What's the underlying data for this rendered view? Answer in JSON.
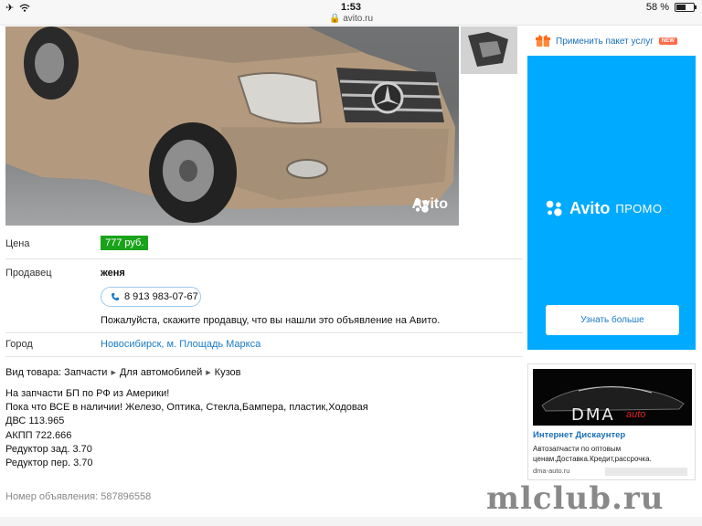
{
  "status_bar": {
    "time": "1:53",
    "url": "avito.ru",
    "battery": "58 %",
    "battery_level": 0.58
  },
  "photo": {
    "watermark": "Avito"
  },
  "listing": {
    "price_label": "Цена",
    "price": "777 руб.",
    "seller_label": "Продавец",
    "seller_name": "женя",
    "phone": "8 913 983-07-67",
    "seller_note": "Пожалуйста, скажите продавцу, что вы нашли это объявление на Авито.",
    "city_label": "Город",
    "city": "Новосибирск, м. Площадь Маркса",
    "breadcrumb": [
      "Вид товара: Запчасти",
      "Для автомобилей",
      "Кузов"
    ],
    "description": [
      "На запчасти БП по РФ из Америки!",
      "Пока что ВСЕ в наличии! Железо, Оптика, Стекла,Бампера, пластик,Ходовая",
      "ДВС 113.965",
      "АКПП 722.666",
      "Редуктор зад. 3.70",
      "Редуктор пер. 3.70"
    ],
    "ad_number": "Номер объявления: 587896558"
  },
  "sidebar": {
    "services_link": "Применить пакет услуг",
    "new_badge": "NEW",
    "promo_brand": "Avito",
    "promo_word": "ПРОМО",
    "promo_button": "Узнать больше",
    "ad": {
      "banner_text": "DMA",
      "banner_sub": "auto",
      "title": "Интернет Дискаунтер",
      "text": "Автозапчасти по оптовым ценам.Доставка.Кредит,рассрочка.",
      "domain": "dma-auto.ru"
    }
  },
  "watermark": "mlclub.ru",
  "colors": {
    "price_bg": "#1aa31a",
    "link": "#1a7bc6",
    "promo_bg": "#00aaff"
  }
}
